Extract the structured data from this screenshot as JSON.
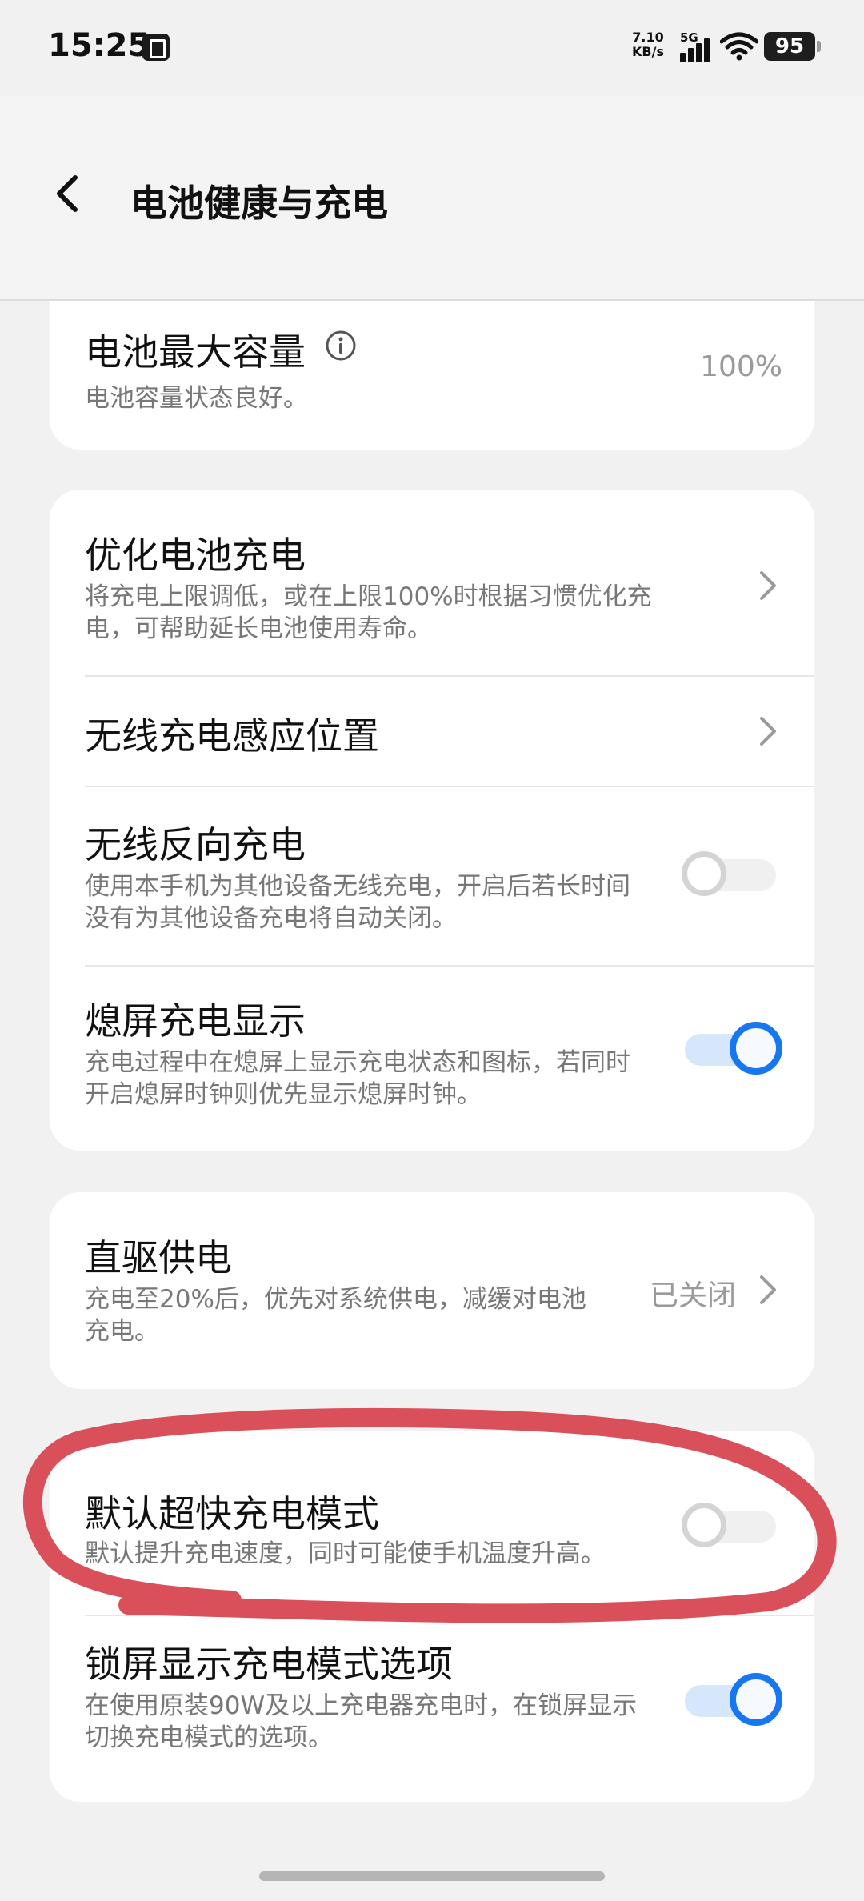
{
  "status_bar": {
    "time": "15:25",
    "net_speed_value": "7.10",
    "net_speed_unit": "KB/s",
    "network": "5G",
    "battery": "95"
  },
  "header": {
    "title": "电池健康与充电"
  },
  "battery_capacity": {
    "title": "电池最大容量",
    "desc": "电池容量状态良好。",
    "value": "100%"
  },
  "charging_card": {
    "optimize": {
      "title": "优化电池充电",
      "desc": "将充电上限调低，或在上限100%时根据习惯优化充电，可帮助延长电池使用寿命。"
    },
    "wireless_position": {
      "title": "无线充电感应位置"
    },
    "reverse_wireless": {
      "title": "无线反向充电",
      "desc": "使用本手机为其他设备无线充电，开启后若长时间没有为其他设备充电将自动关闭。",
      "enabled": false
    },
    "aod_charging": {
      "title": "熄屏充电显示",
      "desc": "充电过程中在熄屏上显示充电状态和图标，若同时开启熄屏时钟则优先显示熄屏时钟。",
      "enabled": true
    }
  },
  "bypass_card": {
    "title": "直驱供电",
    "desc": "充电至20%后，优先对系统供电，减缓对电池充电。",
    "value": "已关闭"
  },
  "super_fast_card": {
    "default_mode": {
      "title": "默认超快充电模式",
      "desc": "默认提升充电速度，同时可能使手机温度升高。",
      "enabled": false
    },
    "lockscreen_options": {
      "title": "锁屏显示充电模式选项",
      "desc": "在使用原装90W及以上充电器充电时，在锁屏显示切换充电模式的选项。",
      "enabled": true
    }
  },
  "colors": {
    "accent": "#1677f0",
    "annotation": "#d9505a"
  }
}
